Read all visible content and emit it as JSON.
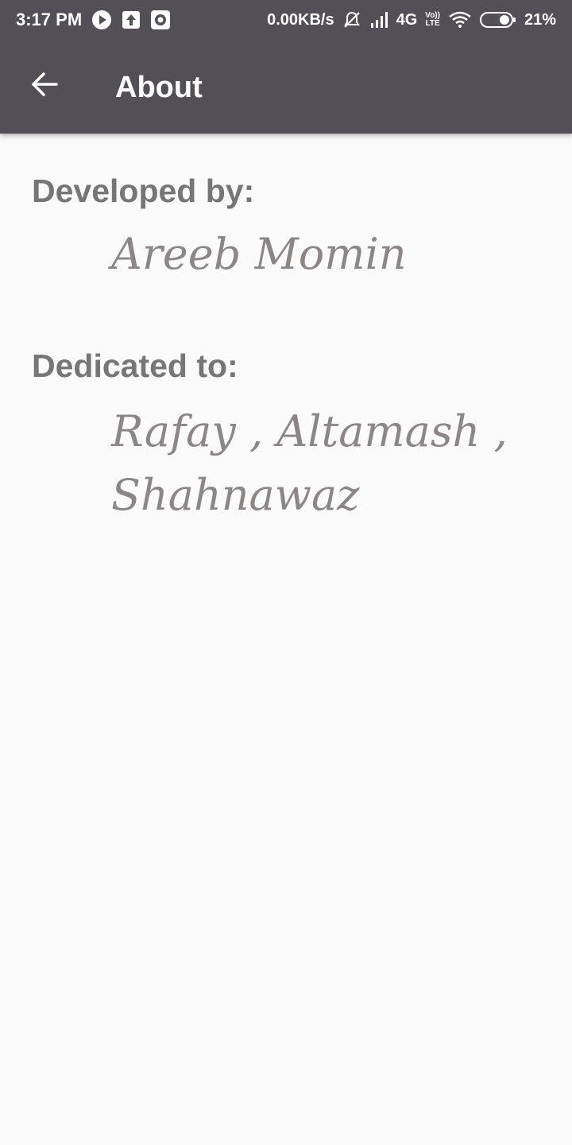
{
  "status_bar": {
    "time": "3:17 PM",
    "net_speed": "0.00KB/s",
    "network_type": "4G",
    "volte_top": "Vo))",
    "volte_bottom": "LTE",
    "battery_percent": "21%",
    "icons": [
      "play-icon",
      "upload-icon",
      "record-icon",
      "mute-alarm-icon",
      "signal-icon",
      "wifi-icon",
      "battery-icon"
    ]
  },
  "app_bar": {
    "title": "About",
    "back_icon": "arrow-left-icon"
  },
  "content": {
    "developed_label": "Developed by:",
    "developer_name": "Areeb Momin",
    "dedicated_label": "Dedicated to:",
    "dedicated_line1": "Rafay , Altamash ,",
    "dedicated_line2": "Shahnawaz"
  },
  "colors": {
    "bar_background": "#524f56",
    "page_background": "#fafafa",
    "heading_text": "#767676",
    "script_text": "#8c8787"
  }
}
